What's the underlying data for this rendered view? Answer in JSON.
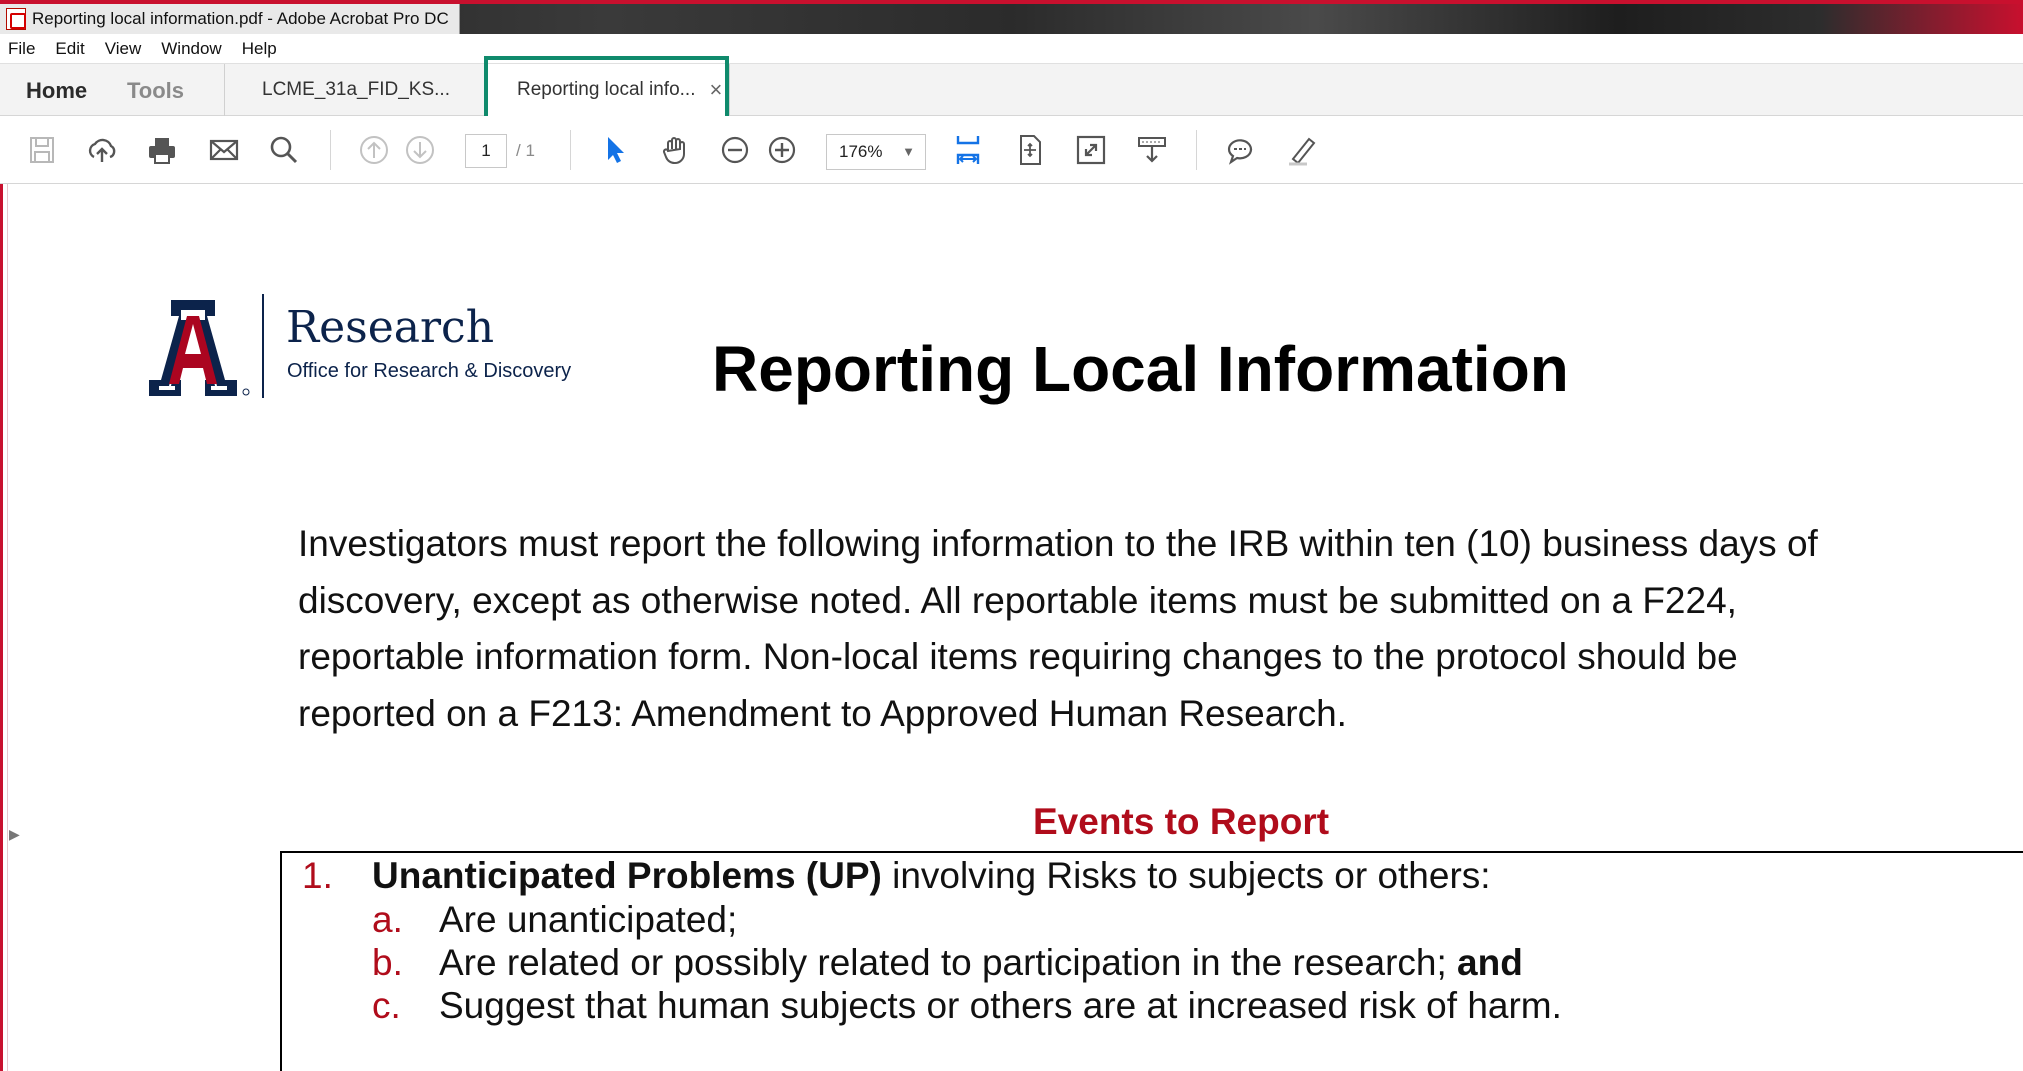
{
  "window": {
    "title": "Reporting local information.pdf - Adobe Acrobat Pro DC"
  },
  "menu": [
    "File",
    "Edit",
    "View",
    "Window",
    "Help"
  ],
  "tabs": {
    "home": "Home",
    "tools": "Tools",
    "documents": [
      {
        "label": "LCME_31a_FID_KS..."
      },
      {
        "label": "Reporting local info...",
        "close": "×"
      }
    ]
  },
  "toolbar": {
    "page_current": "1",
    "page_total": "/ 1",
    "zoom": "176%",
    "zoom_caret": "▼"
  },
  "document": {
    "logo": {
      "research": "Research",
      "subtitle": "Office for Research & Discovery"
    },
    "title": "Reporting Local Information",
    "intro_lines": [
      "Investigators must report the following information to the IRB within ten (10) business days of",
      "discovery, except as otherwise noted. All reportable items must be submitted on a F224,",
      "reportable information form. Non-local items requiring changes to the protocol should be",
      "reported on a F213: Amendment to Approved Human Research."
    ],
    "events_heading": "Events to Report",
    "event_1": {
      "num": "1.",
      "bold": "Unanticipated Problems (UP)",
      "rest": " involving Risks to subjects or others:"
    },
    "sub_items": [
      {
        "letter": "a.",
        "text": "Are unanticipated;"
      },
      {
        "letter": "b.",
        "text": "Are related or possibly related to participation in the research; ",
        "bold": "and"
      },
      {
        "letter": "c.",
        "text": "Suggest that human subjects or others are at increased risk of harm."
      }
    ]
  },
  "colors": {
    "accent_red": "#b00c1b",
    "arizona_navy": "#0c234b",
    "arizona_red": "#ab0520",
    "highlight_green": "#0f8a6c",
    "acrobat_blue": "#1473e6"
  }
}
